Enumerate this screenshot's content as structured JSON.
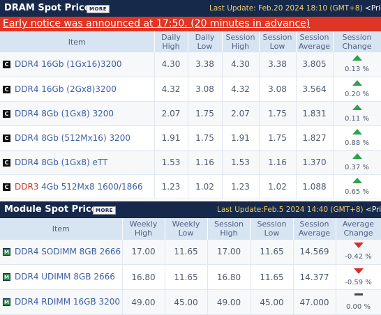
{
  "dram": {
    "title": "DRAM Spot Price",
    "more_label": "MORE",
    "last_update": "Last Update: Feb.20 2024 18:10 (GMT+8)",
    "last_update_tail": "<Price",
    "notice": "Early notice was announced at 17:50. (20 minutes in advance)",
    "headers": {
      "item": "Item",
      "daily_high": [
        "Daily",
        "High"
      ],
      "daily_low": [
        "Daily",
        "Low"
      ],
      "session_high": [
        "Session",
        "High"
      ],
      "session_low": [
        "Session",
        "Low"
      ],
      "session_average": [
        "Session",
        "Average"
      ],
      "session_change": [
        "Session",
        "Change"
      ]
    },
    "rows": [
      {
        "prefix": "",
        "name": "DDR4 16Gb (1Gx16)3200",
        "daily_high": "4.30",
        "daily_low": "3.38",
        "session_high": "4.30",
        "session_low": "3.38",
        "average": "3.805",
        "trend": "up",
        "change": "0.13 %"
      },
      {
        "prefix": "",
        "name": "DDR4 16Gb (2Gx8)3200",
        "daily_high": "4.32",
        "daily_low": "3.08",
        "session_high": "4.32",
        "session_low": "3.08",
        "average": "3.564",
        "trend": "up",
        "change": "0.20 %"
      },
      {
        "prefix": "",
        "name": "DDR4 8Gb (1Gx8) 3200",
        "daily_high": "2.07",
        "daily_low": "1.75",
        "session_high": "2.07",
        "session_low": "1.75",
        "average": "1.831",
        "trend": "up",
        "change": "0.11 %"
      },
      {
        "prefix": "",
        "name": "DDR4 8Gb (512Mx16) 3200",
        "daily_high": "1.91",
        "daily_low": "1.75",
        "session_high": "1.91",
        "session_low": "1.75",
        "average": "1.827",
        "trend": "up",
        "change": "0.88 %"
      },
      {
        "prefix": "",
        "name": "DDR4 8Gb (1Gx8) eTT",
        "daily_high": "1.53",
        "daily_low": "1.16",
        "session_high": "1.53",
        "session_low": "1.16",
        "average": "1.370",
        "trend": "up",
        "change": "0.37 %"
      },
      {
        "prefix": "DDR3",
        "name": " 4Gb 512Mx8 1600/1866",
        "daily_high": "1.23",
        "daily_low": "1.02",
        "session_high": "1.23",
        "session_low": "1.02",
        "average": "1.088",
        "trend": "up",
        "change": "0.65 %"
      }
    ]
  },
  "module": {
    "title": "Module Spot Price",
    "more_label": "MORE",
    "last_update": "Last Update:Feb.5 2024 14:40 (GMT+8)",
    "last_update_tail": "<Price",
    "headers": {
      "item": "Item",
      "weekly_high": [
        "Weekly",
        "High"
      ],
      "weekly_low": [
        "Weekly",
        "Low"
      ],
      "session_high": [
        "Session",
        "High"
      ],
      "session_low": [
        "Session",
        "Low"
      ],
      "session_average": [
        "Session",
        "Average"
      ],
      "average_change": [
        "Average",
        "Change"
      ]
    },
    "rows": [
      {
        "name": "DDR4 SODIMM 8GB 2666",
        "weekly_high": "17.00",
        "weekly_low": "11.65",
        "session_high": "17.00",
        "session_low": "11.65",
        "average": "14.569",
        "trend": "down",
        "change": "-0.42 %"
      },
      {
        "name": "DDR4 UDIMM 8GB 2666",
        "weekly_high": "16.80",
        "weekly_low": "11.65",
        "session_high": "16.80",
        "session_low": "11.65",
        "average": "14.377",
        "trend": "down",
        "change": "-0.59 %"
      },
      {
        "name": "DDR4 RDIMM 16GB 3200",
        "weekly_high": "49.00",
        "weekly_low": "45.00",
        "session_high": "49.00",
        "session_low": "45.00",
        "average": "47.000",
        "trend": "flat",
        "change": "0.00 %"
      }
    ]
  },
  "colors": {
    "header_bg": "#17294a",
    "notice_bg": "#e03524",
    "up": "#2fa24a",
    "down": "#dd2a2a",
    "table_header_bg": "#d7e4f1"
  },
  "icons": {
    "dram_row": "chip-c-icon",
    "module_row": "module-m-icon",
    "up": "arrow-up-icon",
    "down": "arrow-down-icon",
    "flat": "flat-dash-icon"
  }
}
